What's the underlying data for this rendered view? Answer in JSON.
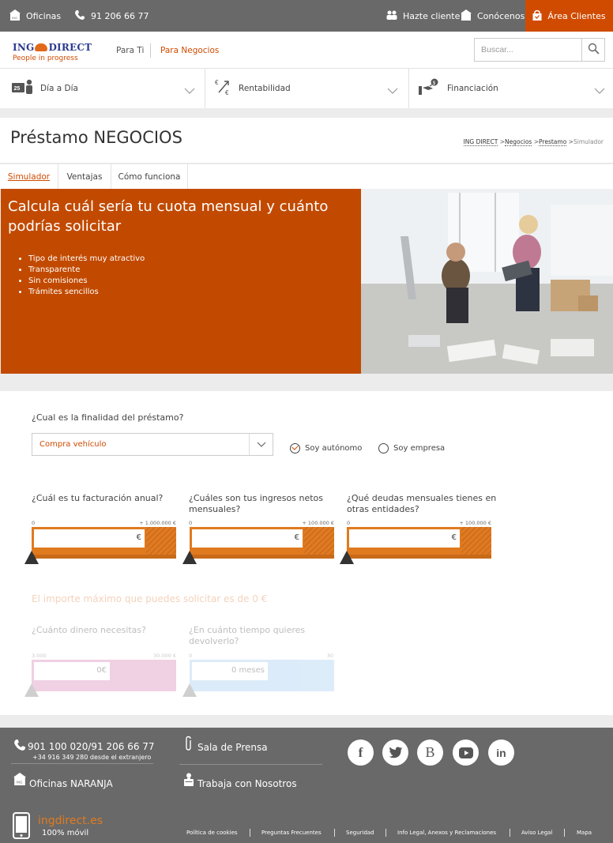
{
  "topbar": {
    "oficinas": "Oficinas",
    "phone": "91 206 66 77",
    "hazte_cliente": "Hazte cliente",
    "conocenos": "Conócenos",
    "area_clientes": "Área Clientes"
  },
  "brand": {
    "name_left": "ING",
    "name_right": "DIRECT",
    "tagline": "People in progress",
    "accent": "#d04b00",
    "dark": "#696969"
  },
  "nav": {
    "para_ti": "Para Ti",
    "para_negocios": "Para Negocios"
  },
  "search": {
    "placeholder": "Buscar..."
  },
  "product_menu": [
    {
      "label": "Día a Día",
      "icon": "calendar-person-icon",
      "badge": "25"
    },
    {
      "label": "Rentabilidad",
      "icon": "currency-exchange-icon"
    },
    {
      "label": "Financiación",
      "icon": "hand-money-icon"
    }
  ],
  "page": {
    "title": "Préstamo NEGOCIOS",
    "breadcrumb": [
      {
        "label": "ING DIRECT",
        "link": true
      },
      {
        "label": "Negocios",
        "link": true
      },
      {
        "label": "Prestamo",
        "link": true
      },
      {
        "label": "Simulador",
        "link": false
      }
    ]
  },
  "tabs": [
    {
      "label": "Simulador",
      "active": true
    },
    {
      "label": "Ventajas",
      "active": false
    },
    {
      "label": "Cómo funciona",
      "active": false
    }
  ],
  "hero": {
    "title": "Calcula cuál sería tu cuota mensual y cuánto podrías solicitar",
    "bullets": [
      "Tipo de interés muy atractivo",
      "Transparente",
      "Sin comisiones",
      "Trámites sencillos"
    ]
  },
  "simulator": {
    "finalidad_label": "¿Cual es la finalidad del préstamo?",
    "finalidad_value": "Compra vehículo",
    "radio_autonomo": "Soy autónomo",
    "radio_empresa": "Soy empresa",
    "selected_radio": "autonomo",
    "sliders": [
      {
        "label": "¿Cuál es tu facturación anual?",
        "min": "0",
        "max": "+ 1.000.000 €",
        "value": "",
        "unit": "€",
        "level": 0
      },
      {
        "label": "¿Cuáles son tus ingresos netos mensuales?",
        "min": "0",
        "max": "+ 100.000 €",
        "value": "",
        "unit": "€",
        "level": 0
      },
      {
        "label": "¿Qué deudas mensuales tienes en otras entidades?",
        "min": "0",
        "max": "+ 100.000 €",
        "value": "",
        "unit": "€",
        "level": 0
      }
    ],
    "max_importe_text": "El importe máximo que puedes solicitar es de 0 €",
    "dinero_label": "¿Cuánto dinero necesitas?",
    "dinero_min": "3.000",
    "dinero_max": "30.000 €",
    "dinero_value": "0",
    "dinero_unit": "€",
    "tiempo_label": "¿En cuánto tiempo quieres devolverlo?",
    "tiempo_min": "0",
    "tiempo_max": "30",
    "tiempo_value": "0",
    "tiempo_unit": "meses"
  },
  "footer": {
    "phone": "901 100 020/91 206 66 77",
    "phone_extranjero": "+34 916 349 280 desde el extranjero",
    "oficinas": "Oficinas NARANJA",
    "sala_prensa": "Sala de Prensa",
    "trabaja": "Trabaja con Nosotros",
    "site": "ingdirect.es",
    "movil": "100% móvil",
    "social": [
      "facebook-icon",
      "twitter-icon",
      "blog-icon",
      "youtube-icon",
      "linkedin-icon"
    ],
    "social_letters": [
      "f",
      "",
      "B",
      "",
      "in"
    ],
    "links": [
      "Política de cookies",
      "Preguntas Frecuentes",
      "Seguridad",
      "Info Legal, Anexos y Reclamaciones",
      "Aviso Legal",
      "Mapa"
    ]
  }
}
